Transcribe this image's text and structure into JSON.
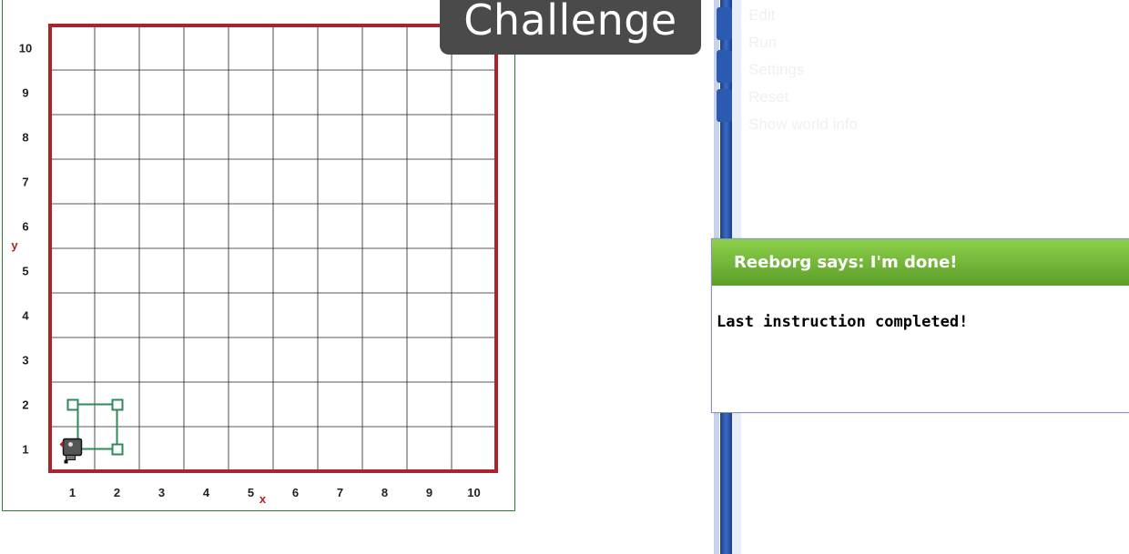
{
  "world": {
    "x_label": "x",
    "y_label": "y",
    "x_ticks": [
      "1",
      "2",
      "3",
      "4",
      "5",
      "6",
      "7",
      "8",
      "9",
      "10"
    ],
    "y_ticks": [
      "1",
      "2",
      "3",
      "4",
      "5",
      "6",
      "7",
      "8",
      "9",
      "10"
    ],
    "robot": {
      "x": 1,
      "y": 1,
      "facing": "west"
    },
    "path_markers": [
      {
        "x": 1,
        "y": 2
      },
      {
        "x": 2,
        "y": 2
      },
      {
        "x": 2,
        "y": 1
      }
    ],
    "colors": {
      "wall": "#a8262b",
      "grid": "#222222",
      "path": "#2e8b57",
      "axis_letter": "#b22222"
    }
  },
  "banner": {
    "text": "Challenge"
  },
  "menu": {
    "items": [
      "Edit",
      "Run",
      "Settings",
      "Reset",
      "Show world info"
    ]
  },
  "dialog": {
    "title": "Reeborg says: I'm done!",
    "message": "Last instruction completed!"
  }
}
